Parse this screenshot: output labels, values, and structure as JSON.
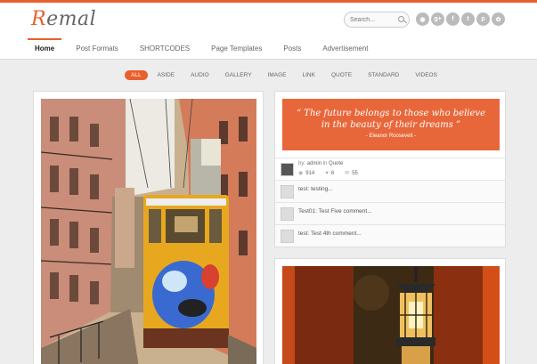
{
  "brand": {
    "logo_text": "Remal",
    "accent": "#e8602c"
  },
  "search": {
    "placeholder": "Search..."
  },
  "socials": [
    "rss-icon",
    "google-plus-icon",
    "facebook-icon",
    "twitter-icon",
    "pinterest-icon",
    "share-icon"
  ],
  "nav": {
    "items": [
      {
        "label": "Home",
        "active": true
      },
      {
        "label": "Post Formats"
      },
      {
        "label": "SHORTCODES"
      },
      {
        "label": "Page Templates"
      },
      {
        "label": "Posts"
      },
      {
        "label": "Advertisement"
      }
    ]
  },
  "filters": [
    "ALL",
    "ASIDE",
    "AUDIO",
    "GALLERY",
    "IMAGE",
    "LINK",
    "QUOTE",
    "STANDARD",
    "VIDEOS"
  ],
  "quote_post": {
    "text": "“ The future belongs to those who believe in the beauty of their dreams ”",
    "author": "- Eleanor Roosevelt -",
    "meta": {
      "by": "by:",
      "author": "admin",
      "in": "in",
      "category": "Quote"
    },
    "stats": {
      "views": "914",
      "likes": "6",
      "comments": "55"
    },
    "comments": [
      "test: testing...",
      "Test01: Test Five comment...",
      "test: Test 4th comment..."
    ]
  }
}
